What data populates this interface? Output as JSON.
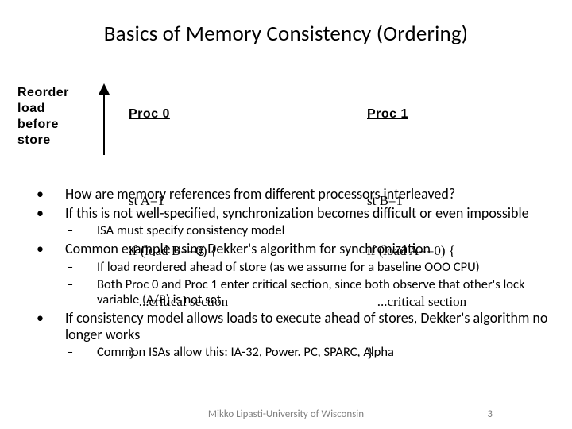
{
  "title": "Basics of Memory Consistency (Ordering)",
  "diagram": {
    "reorder_lines": [
      "Reorder",
      "load",
      "before",
      "store"
    ],
    "proc0": {
      "head": "Proc 0",
      "lines": [
        "st A=1",
        "if (load B==0) {",
        "   ...critical section",
        "}"
      ]
    },
    "proc1": {
      "head": "Proc 1",
      "lines": [
        "st B=1",
        "if (load A==0) {",
        "   ...critical section",
        "}"
      ]
    }
  },
  "bullets": [
    {
      "level": 1,
      "text": "How are memory references from different processors interleaved?"
    },
    {
      "level": 1,
      "text": "If this is not well-specified, synchronization becomes difficult or even impossible"
    },
    {
      "level": 2,
      "text": "ISA must specify consistency model"
    },
    {
      "level": 1,
      "text": "Common example using Dekker's algorithm for synchronization"
    },
    {
      "level": 2,
      "text": "If load reordered ahead of store (as we assume for a baseline OOO CPU)"
    },
    {
      "level": 2,
      "text": "Both Proc 0 and Proc 1 enter critical section, since both observe that other's lock variable (A/B) is not set"
    },
    {
      "level": 1,
      "text": "If consistency model allows loads to execute ahead of stores, Dekker's algorithm no longer works"
    },
    {
      "level": 2,
      "text": "Common ISAs allow this: IA-32, Power. PC, SPARC, Alpha"
    }
  ],
  "footer": {
    "text": "Mikko Lipasti-University of Wisconsin",
    "page": "3"
  }
}
